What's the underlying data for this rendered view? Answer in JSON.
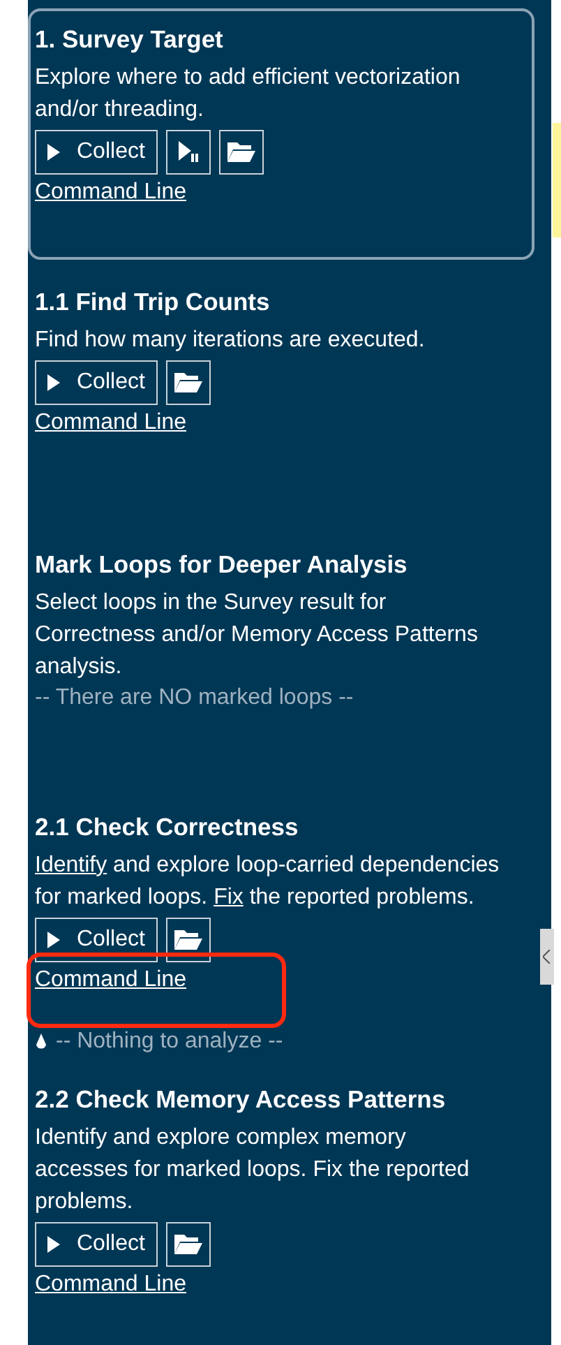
{
  "sections": [
    {
      "title": "1. Survey Target",
      "selected": true,
      "description": [
        {
          "kind": "text",
          "text": "Explore where to add efficient vectorization and/or threading."
        }
      ],
      "buttons": [
        {
          "kind": "collect",
          "label": "Collect"
        },
        {
          "kind": "pause"
        },
        {
          "kind": "folder"
        }
      ],
      "command_line": "Command Line"
    },
    {
      "title": "1.1 Find Trip Counts",
      "selected": false,
      "description": [
        {
          "kind": "text",
          "text": "Find how many iterations are executed."
        }
      ],
      "buttons": [
        {
          "kind": "collect",
          "label": "Collect"
        },
        {
          "kind": "folder"
        }
      ],
      "command_line": "Command Line"
    },
    {
      "title": "Mark Loops for Deeper Analysis",
      "selected": false,
      "description": [
        {
          "kind": "text",
          "text": "Select loops in the Survey result for Correctness and/or Memory Access Patterns analysis."
        }
      ],
      "note": {
        "text": "-- There are NO marked loops --",
        "icon": false
      }
    },
    {
      "title": "2.1 Check Correctness",
      "selected": false,
      "description": [
        {
          "kind": "link",
          "text": "Identify"
        },
        {
          "kind": "text",
          "text": " and explore loop-carried dependencies for marked loops. "
        },
        {
          "kind": "link",
          "text": "Fix"
        },
        {
          "kind": "text",
          "text": " the reported problems."
        }
      ],
      "buttons": [
        {
          "kind": "collect",
          "label": "Collect"
        },
        {
          "kind": "folder"
        }
      ],
      "command_line": "Command Line",
      "highlighted": true,
      "note": {
        "text": "-- Nothing to analyze --",
        "icon": true
      }
    },
    {
      "title": "2.2 Check Memory Access Patterns",
      "selected": false,
      "description": [
        {
          "kind": "text",
          "text": "Identify and explore complex memory accesses for marked loops. Fix the reported problems."
        }
      ],
      "buttons": [
        {
          "kind": "collect",
          "label": "Collect"
        },
        {
          "kind": "folder"
        }
      ],
      "command_line": "Command Line"
    }
  ]
}
